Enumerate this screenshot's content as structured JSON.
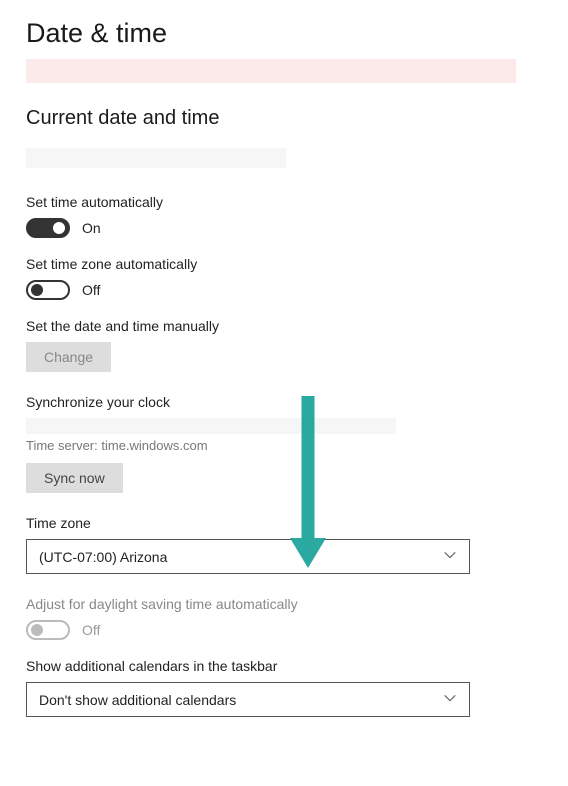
{
  "pageTitle": "Date & time",
  "sectionTitle": "Current date and time",
  "setTimeAuto": {
    "label": "Set time automatically",
    "state": "On",
    "on": true
  },
  "setZoneAuto": {
    "label": "Set time zone automatically",
    "state": "Off",
    "on": false
  },
  "manual": {
    "label": "Set the date and time manually",
    "button": "Change"
  },
  "sync": {
    "label": "Synchronize your clock",
    "server": "Time server: time.windows.com",
    "button": "Sync now"
  },
  "timeZone": {
    "label": "Time zone",
    "selected": "(UTC-07:00) Arizona"
  },
  "dst": {
    "label": "Adjust for daylight saving time automatically",
    "state": "Off",
    "on": false
  },
  "calendars": {
    "label": "Show additional calendars in the taskbar",
    "selected": "Don't show additional calendars"
  }
}
